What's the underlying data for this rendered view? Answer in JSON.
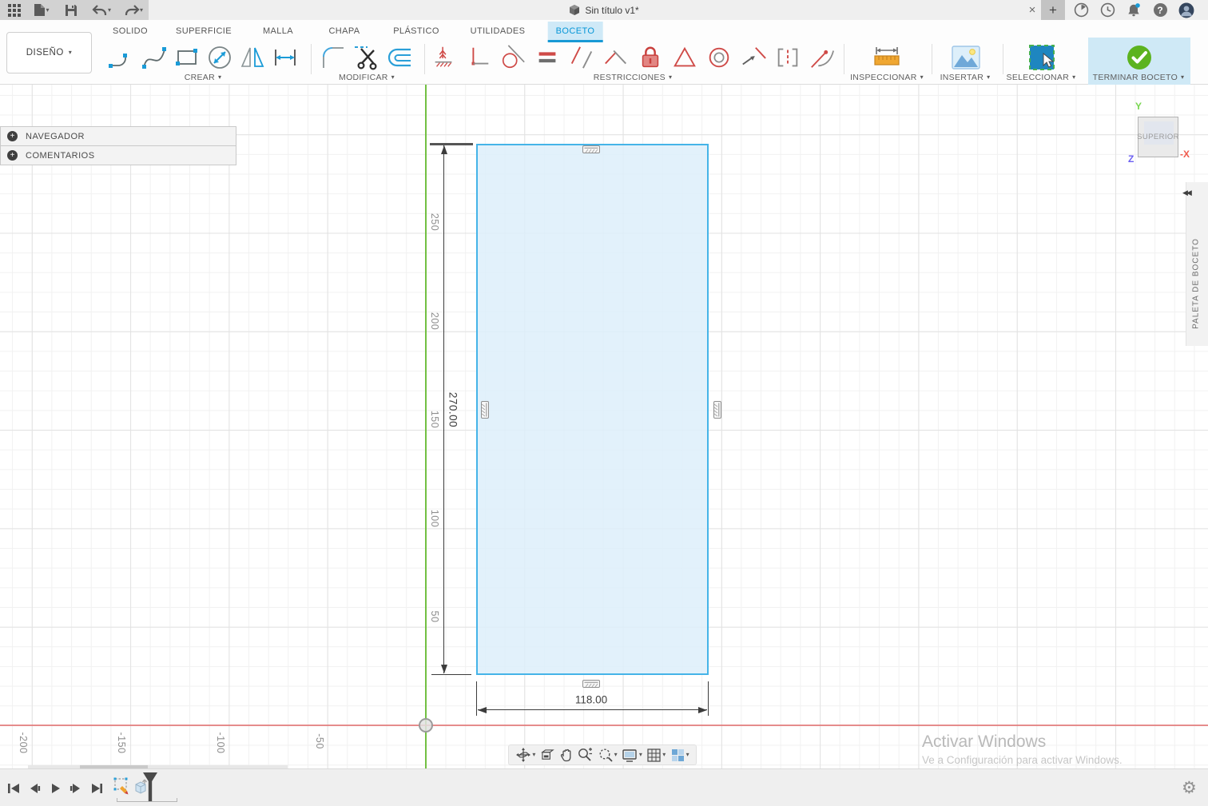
{
  "titlebar": {
    "title": "Sin título v1*"
  },
  "ui": {
    "caret": "▾",
    "close": "×",
    "plus": "+",
    "collapse": "◀◀",
    "help": "?",
    "plus_small": "+"
  },
  "tabs": [
    "SOLIDO",
    "SUPERFICIE",
    "MALLA",
    "CHAPA",
    "PLÁSTICO",
    "UTILIDADES",
    "BOCETO"
  ],
  "toolbar": {
    "design_label": "DISEÑO",
    "groups": {
      "crear": "CREAR",
      "modificar": "MODIFICAR",
      "restricciones": "RESTRICCIONES",
      "inspeccionar": "INSPECCIONAR",
      "insertar": "INSERTAR",
      "seleccionar": "SELECCIONAR",
      "terminar": "TERMINAR BOCETO"
    }
  },
  "panels": {
    "navegador": "NAVEGADOR",
    "comentarios": "COMENTARIOS"
  },
  "viewcube": {
    "face": "SUPERIOR",
    "axis_y": "Y",
    "axis_x": "-X",
    "axis_z": "Z"
  },
  "sketch_palette_label": "PALETA DE BOCETO",
  "canvas": {
    "v_ruler": [
      "250",
      "200",
      "150",
      "100",
      "50"
    ],
    "h_ruler": [
      "-200",
      "-150",
      "-100",
      "-50"
    ],
    "dimensions": {
      "height": "270.00",
      "width": "118.00"
    }
  },
  "watermark": {
    "line1": "Activar Windows",
    "line2": "Ve a Configuración para activar Windows."
  },
  "colors": {
    "accent": "#0696d7",
    "active_tab_bg": "#cfe9f7",
    "axis_x_red": "#e47373",
    "axis_y_green": "#72c043",
    "sketch_fill": "#ddeffa",
    "sketch_stroke": "#45b4e8",
    "check_green": "#5cb31f",
    "constraint_red": "#cf4a47"
  }
}
